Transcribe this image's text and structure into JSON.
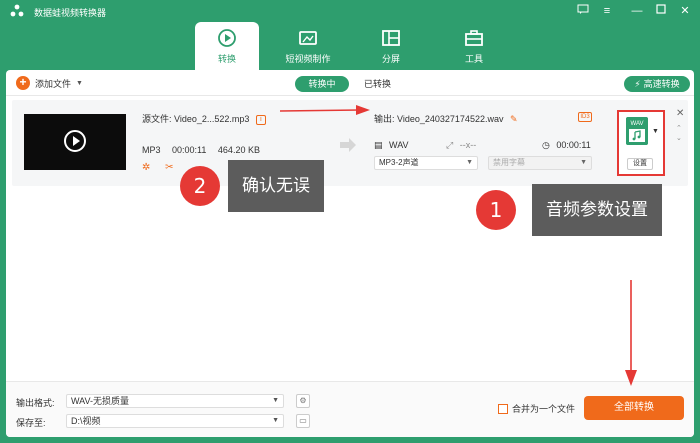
{
  "app": {
    "title": "数据蛙视频转换器"
  },
  "nav": {
    "tabs": [
      {
        "label": "转换",
        "icon": "convert-icon",
        "active": true
      },
      {
        "label": "短视频制作",
        "icon": "tv-icon",
        "active": false
      },
      {
        "label": "分屏",
        "icon": "split-screen-icon",
        "active": false
      },
      {
        "label": "工具",
        "icon": "toolbox-icon",
        "active": false
      }
    ]
  },
  "toolbar": {
    "add_file": "添加文件",
    "converting": "转换中",
    "converted": "已转换",
    "fast_convert": "高速转换"
  },
  "file": {
    "source_label": "源文件:",
    "source_name": "Video_2...522.mp3",
    "format": "MP3",
    "duration": "00:00:11",
    "size": "464.20 KB",
    "output_label": "输出:",
    "output_name": "Video_240327174522.wav",
    "out_format": "WAV",
    "out_resolution": "--x--",
    "out_duration": "00:00:11",
    "channel": "MP3-2声道",
    "subtitle": "禁用字幕",
    "id3": "ID3",
    "format_badge": "WAV",
    "settings_label": "设置"
  },
  "annotations": {
    "step1_num": "1",
    "step1_text": "音频参数设置",
    "step2_num": "2",
    "step2_text": "确认无误"
  },
  "bottom": {
    "output_format_label": "输出格式:",
    "output_format_value": "WAV-无损质量",
    "save_to_label": "保存至:",
    "save_to_value": "D:\\视频",
    "merge_label": "合并为一个文件",
    "convert_all": "全部转换"
  },
  "colors": {
    "brand_green": "#2e9e6e",
    "accent_orange": "#f06a1b",
    "annotation_red": "#e53935",
    "annotation_gray": "#5c5c5c"
  }
}
